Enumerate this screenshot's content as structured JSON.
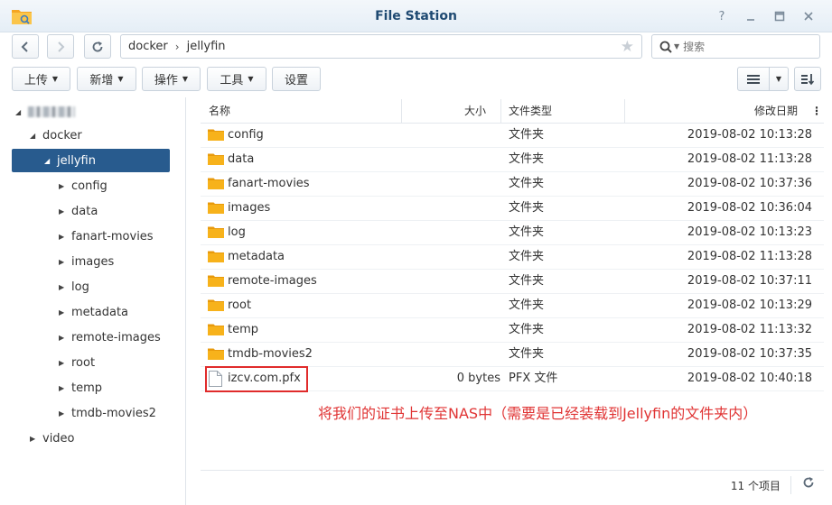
{
  "window": {
    "title": "File Station",
    "help_icon": "help-icon",
    "minimize_icon": "minimize-icon",
    "maximize_icon": "maximize-icon",
    "close_icon": "close-icon"
  },
  "address": {
    "path": [
      "docker",
      "jellyfin"
    ],
    "search_placeholder": "搜索"
  },
  "toolbar": {
    "upload": "上传",
    "create": "新增",
    "action": "操作",
    "tools": "工具",
    "settings": "设置"
  },
  "tree": {
    "root_label_blurred": true,
    "docker": "docker",
    "jellyfin": "jellyfin",
    "children": [
      "config",
      "data",
      "fanart-movies",
      "images",
      "log",
      "metadata",
      "remote-images",
      "root",
      "temp",
      "tmdb-movies2"
    ],
    "video": "video"
  },
  "columns": {
    "name": "名称",
    "size": "大小",
    "type": "文件类型",
    "modified": "修改日期"
  },
  "files": [
    {
      "name": "config",
      "size": "",
      "type": "文件夹",
      "modified": "2019-08-02 10:13:28",
      "kind": "folder"
    },
    {
      "name": "data",
      "size": "",
      "type": "文件夹",
      "modified": "2019-08-02 11:13:28",
      "kind": "folder"
    },
    {
      "name": "fanart-movies",
      "size": "",
      "type": "文件夹",
      "modified": "2019-08-02 10:37:36",
      "kind": "folder"
    },
    {
      "name": "images",
      "size": "",
      "type": "文件夹",
      "modified": "2019-08-02 10:36:04",
      "kind": "folder"
    },
    {
      "name": "log",
      "size": "",
      "type": "文件夹",
      "modified": "2019-08-02 10:13:23",
      "kind": "folder"
    },
    {
      "name": "metadata",
      "size": "",
      "type": "文件夹",
      "modified": "2019-08-02 11:13:28",
      "kind": "folder"
    },
    {
      "name": "remote-images",
      "size": "",
      "type": "文件夹",
      "modified": "2019-08-02 10:37:11",
      "kind": "folder"
    },
    {
      "name": "root",
      "size": "",
      "type": "文件夹",
      "modified": "2019-08-02 10:13:29",
      "kind": "folder"
    },
    {
      "name": "temp",
      "size": "",
      "type": "文件夹",
      "modified": "2019-08-02 11:13:32",
      "kind": "folder"
    },
    {
      "name": "tmdb-movies2",
      "size": "",
      "type": "文件夹",
      "modified": "2019-08-02 10:37:35",
      "kind": "folder"
    },
    {
      "name": "izcv.com.pfx",
      "size": "0 bytes",
      "type": "PFX 文件",
      "modified": "2019-08-02 10:40:18",
      "kind": "file"
    }
  ],
  "annotation": "将我们的证书上传至NAS中（需要是已经装载到Jellyfin的文件夹内）",
  "status": {
    "item_count": "11 个项目"
  },
  "colors": {
    "selected": "#285b8e",
    "folder": "#f7b21b",
    "annotation": "#e03434",
    "title": "#1f4a72"
  }
}
